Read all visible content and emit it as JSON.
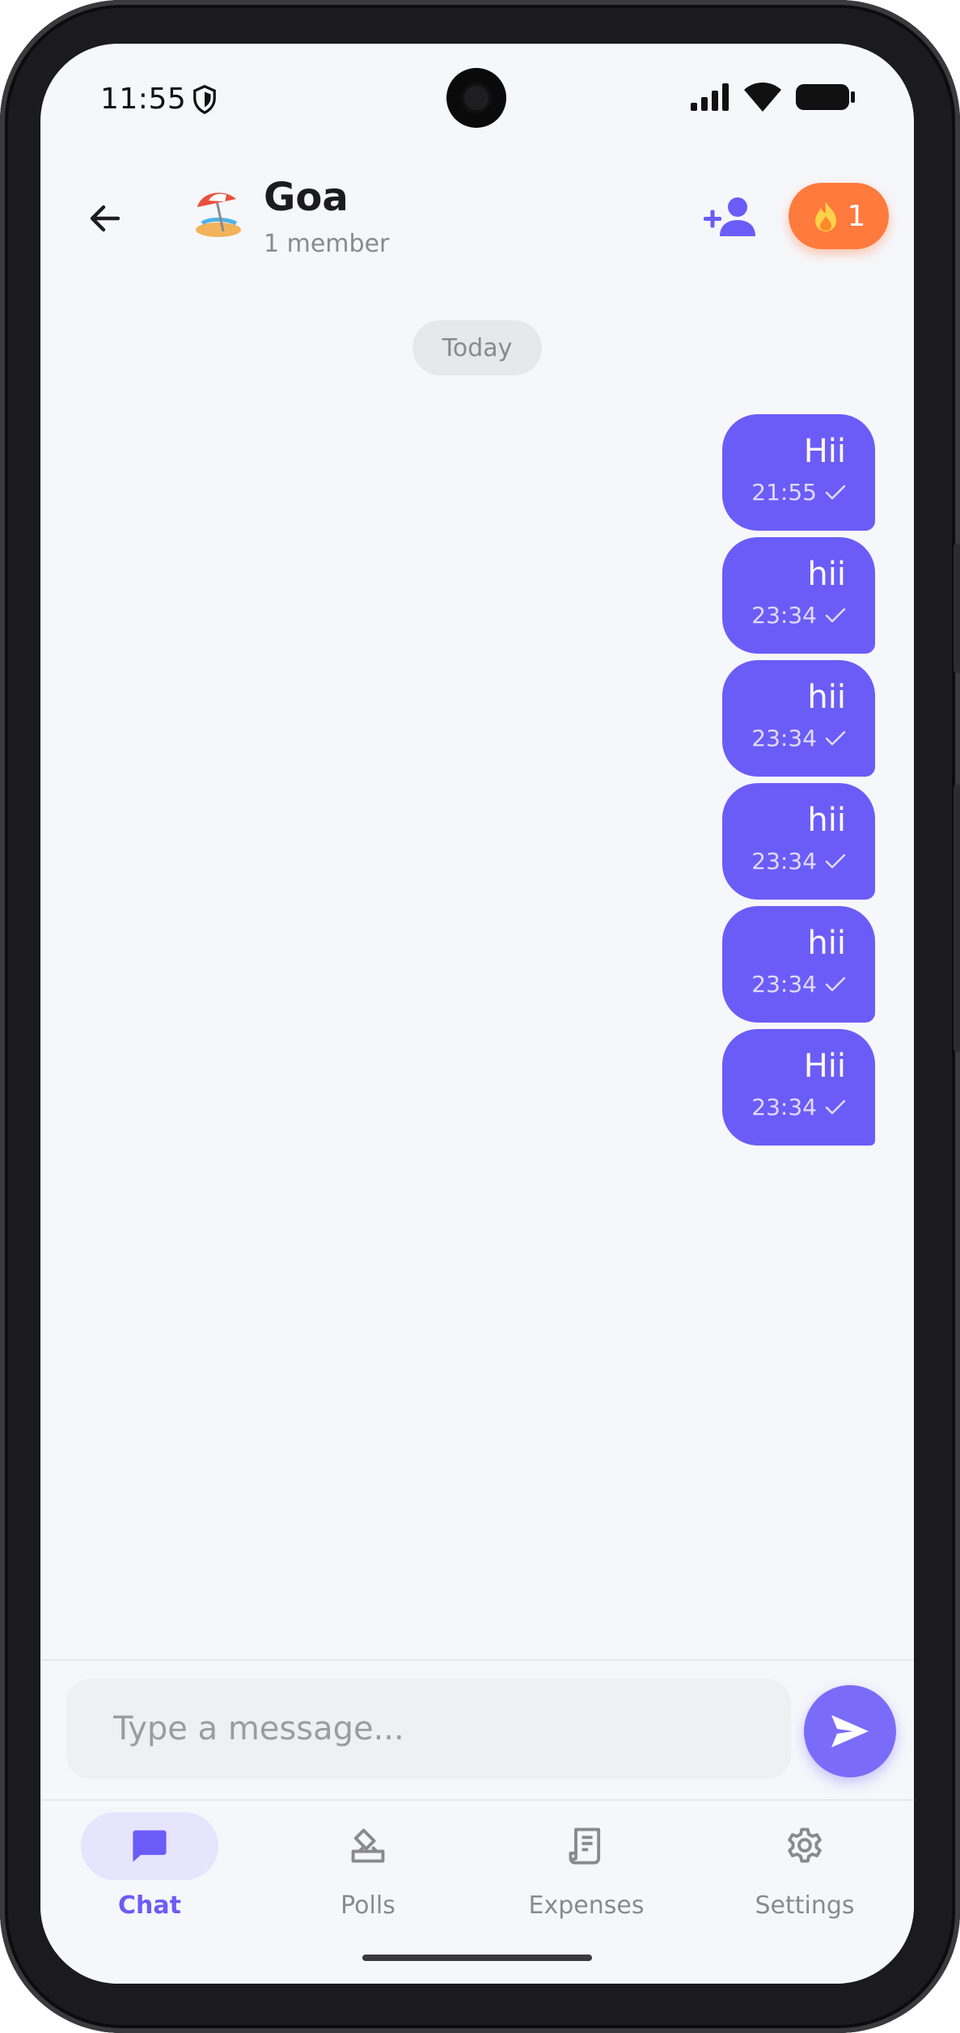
{
  "status_bar": {
    "time": "11:55",
    "icons": [
      "shield-icon",
      "signal-icon",
      "wifi-icon",
      "battery-icon"
    ]
  },
  "header": {
    "group_emoji": "beach-umbrella-icon",
    "group_name": "Goa",
    "member_count": "1 member",
    "streak_icon": "fire-icon",
    "streak_count": "1"
  },
  "chat": {
    "date_separator": "Today",
    "messages": [
      {
        "text": "Hii",
        "time": "21:55",
        "status": "sent"
      },
      {
        "text": "hii",
        "time": "23:34",
        "status": "sent"
      },
      {
        "text": "hii",
        "time": "23:34",
        "status": "sent"
      },
      {
        "text": "hii",
        "time": "23:34",
        "status": "sent"
      },
      {
        "text": "hii",
        "time": "23:34",
        "status": "sent"
      },
      {
        "text": "Hii",
        "time": "23:34",
        "status": "sent"
      }
    ]
  },
  "composer": {
    "placeholder": "Type a message...",
    "value": ""
  },
  "nav": {
    "items": [
      {
        "label": "Chat",
        "icon": "chat-icon",
        "active": true
      },
      {
        "label": "Polls",
        "icon": "ballot-icon",
        "active": false
      },
      {
        "label": "Expenses",
        "icon": "receipt-icon",
        "active": false
      },
      {
        "label": "Settings",
        "icon": "gear-icon",
        "active": false
      }
    ]
  },
  "colors": {
    "accent": "#6c5cf7",
    "streak": "#ff7a3d",
    "background": "#f6f7fb"
  }
}
